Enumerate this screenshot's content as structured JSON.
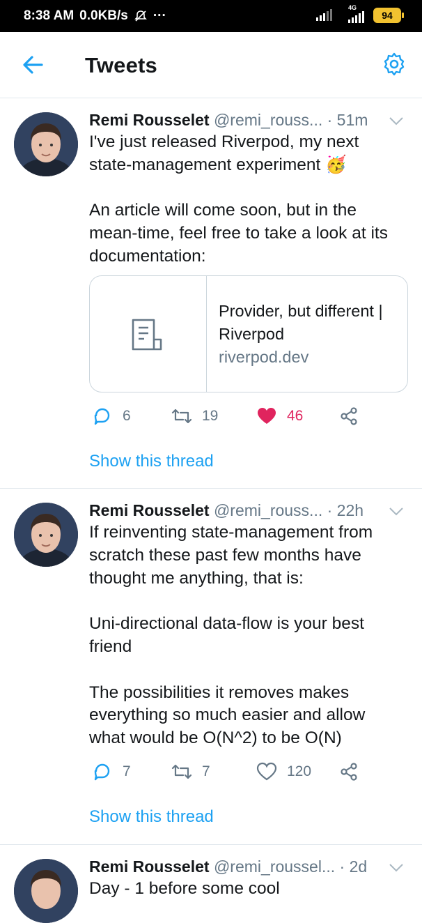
{
  "status_bar": {
    "time": "8:38 AM",
    "speed": "0.0KB/s",
    "more": "···",
    "network": "4G",
    "battery": "94",
    "icons": [
      "muted-icon",
      "signal-icon",
      "battery-icon"
    ]
  },
  "app_bar": {
    "title": "Tweets",
    "back_icon": "arrow-left-icon",
    "settings_icon": "gear-icon"
  },
  "colors": {
    "accent": "#1da1f2",
    "like": "#e0245e",
    "secondary_text": "#657786",
    "divider": "#e1e8ed"
  },
  "tweets": [
    {
      "name": "Remi Rousselet",
      "handle": "@remi_rouss...",
      "time": "· 51m",
      "text": "I've just released Riverpod, my next state-management experiment 🥳\n\nAn article will come soon, but in the mean-time, feel free to take a look at its documentation:",
      "card": {
        "title": "Provider, but different | Riverpod",
        "domain": "riverpod.dev"
      },
      "replies": "6",
      "retweets": "19",
      "likes": "46",
      "liked": true,
      "show_thread": "Show this thread"
    },
    {
      "name": "Remi Rousselet",
      "handle": "@remi_rouss...",
      "time": "· 22h",
      "text": "If reinventing state-management from scratch these past few months have thought me anything, that is:\n\nUni-directional data-flow is your best friend\n\nThe possibilities it removes makes everything so much easier and allow what would be O(N^2) to be O(N)",
      "replies": "7",
      "retweets": "7",
      "likes": "120",
      "liked": false,
      "show_thread": "Show this thread"
    },
    {
      "name": "Remi Rousselet",
      "handle": "@remi_roussel...",
      "time": "· 2d",
      "text": "Day - 1 before some cool"
    }
  ]
}
